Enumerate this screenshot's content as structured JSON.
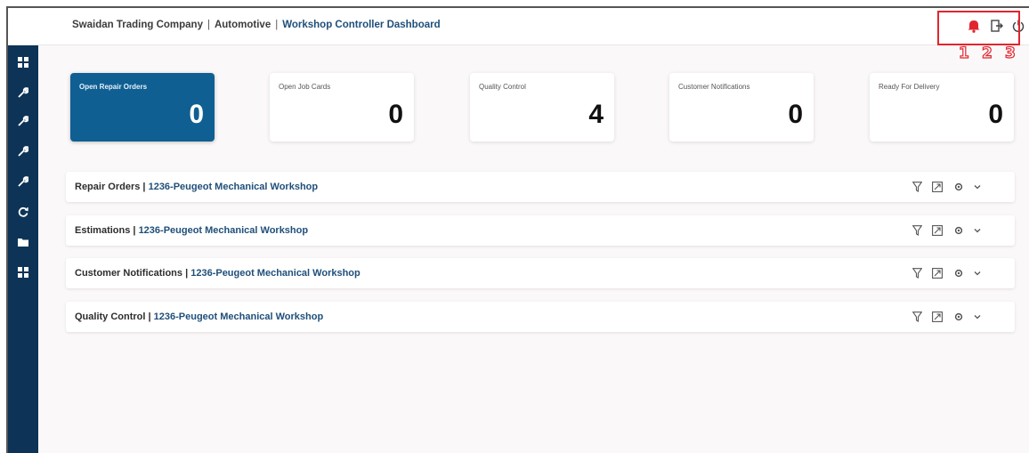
{
  "header": {
    "company": "Swaidan Trading Company",
    "division": "Automotive",
    "dashboard": "Workshop Controller Dashboard",
    "separator": "|"
  },
  "top_icons": [
    {
      "name": "notification-bell-icon"
    },
    {
      "name": "exit-icon"
    },
    {
      "name": "power-icon"
    }
  ],
  "annotation": {
    "highlight_color": "#e0262f",
    "callouts": [
      "1",
      "2",
      "3"
    ]
  },
  "sidebar": {
    "background": "#0d3457",
    "icons": [
      "grid-icon",
      "wrench-icon",
      "wrench-icon",
      "wrench-icon",
      "wrench-icon",
      "refresh-icon",
      "folder-icon",
      "grid-icon"
    ]
  },
  "summary_cards": [
    {
      "label": "Open Repair Orders",
      "value": "0",
      "active": true
    },
    {
      "label": "Open Job Cards",
      "value": "0",
      "active": false
    },
    {
      "label": "Quality Control",
      "value": "4",
      "active": false
    },
    {
      "label": "Customer Notifications",
      "value": "0",
      "active": false
    },
    {
      "label": "Ready For Delivery",
      "value": "0",
      "active": false
    }
  ],
  "panels": [
    {
      "title": "Repair Orders",
      "workshop": "1236-Peugeot Mechanical Workshop"
    },
    {
      "title": "Estimations",
      "workshop": "1236-Peugeot Mechanical Workshop"
    },
    {
      "title": "Customer Notifications",
      "workshop": "1236-Peugeot Mechanical Workshop"
    },
    {
      "title": "Quality Control",
      "workshop": "1236-Peugeot Mechanical Workshop"
    }
  ],
  "panel_tool_icons": [
    "filter-icon",
    "export-icon",
    "settings-icon",
    "chevron-down-icon"
  ],
  "colors": {
    "brand_dark": "#0d3457",
    "accent": "#0f5f92",
    "link": "#1f4f7a"
  }
}
